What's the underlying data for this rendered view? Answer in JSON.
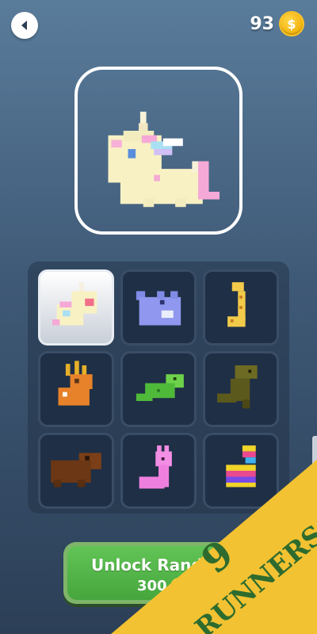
{
  "header": {
    "back_icon": "chevron-left-icon",
    "coin_count": "93",
    "coin_symbol": "$"
  },
  "preview": {
    "character": "unicorn"
  },
  "grid": {
    "characters": [
      {
        "name": "unicorn",
        "selected": true
      },
      {
        "name": "hippo"
      },
      {
        "name": "giraffe"
      },
      {
        "name": "deer"
      },
      {
        "name": "crocodile"
      },
      {
        "name": "t-rex"
      },
      {
        "name": "bear"
      },
      {
        "name": "llama"
      },
      {
        "name": "pinata-llama"
      }
    ]
  },
  "unlock": {
    "label": "Unlock Rand",
    "price": "300"
  },
  "watermark": {
    "number": "9",
    "text": "RUNNERS"
  },
  "colors": {
    "unlock_green": "#4fb244",
    "coin_gold": "#f2b10c",
    "watermark_yellow": "#f2c232"
  }
}
